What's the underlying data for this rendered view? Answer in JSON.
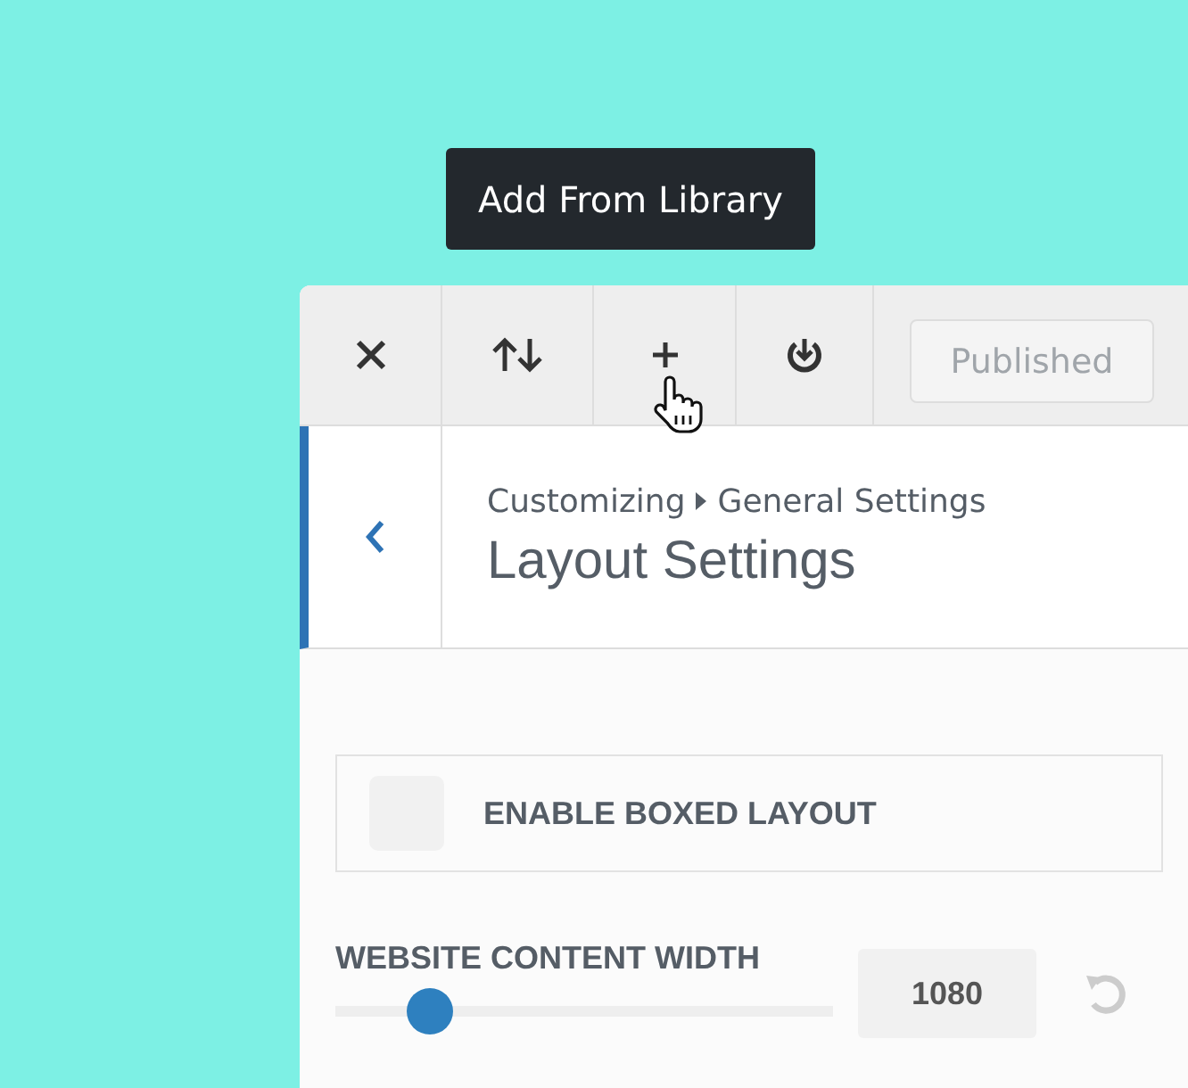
{
  "tooltip": {
    "text": "Add From Library"
  },
  "toolbar": {
    "buttons": [
      {
        "kind": "close"
      },
      {
        "kind": "sort"
      },
      {
        "kind": "add"
      },
      {
        "kind": "power"
      }
    ],
    "publish_button": {
      "label": "Published",
      "disabled": true
    }
  },
  "header": {
    "breadcrumb": [
      "Customizing",
      "General Settings"
    ],
    "title": "Layout Settings"
  },
  "options": [
    {
      "kind": "checkbox",
      "label": "ENABLE BOXED LAYOUT",
      "checked": false
    },
    {
      "kind": "slider",
      "label": "WEBSITE CONTENT WIDTH",
      "level": 0.16,
      "value": "1080"
    }
  ]
}
